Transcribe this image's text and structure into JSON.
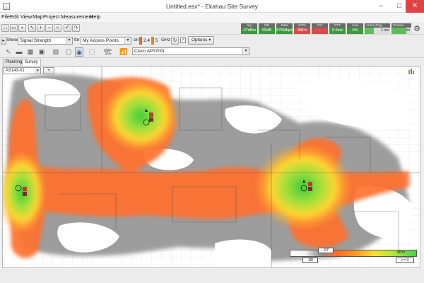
{
  "app": {
    "window_title": "Untitled.esx* - Ekahau Site Survey",
    "min_glyph": "–",
    "max_glyph": "□",
    "close_glyph": "✕"
  },
  "menu": [
    "File",
    "Edit",
    "View",
    "Map",
    "Project",
    "Measurement",
    "Help"
  ],
  "metrics": [
    {
      "label": "Sig",
      "value": "-37dBm",
      "status": "good"
    },
    {
      "label": "S/N",
      "value": "55dB",
      "status": "good"
    },
    {
      "label": "Data",
      "value": "975Mbps",
      "status": "good"
    },
    {
      "label": "#APs",
      "value": "3APs",
      "status": "bad"
    },
    {
      "label": "CCI",
      "value": "-",
      "status": "bad"
    },
    {
      "label": "RTT",
      "value": "0.9ms",
      "status": "good"
    },
    {
      "label": "Loss",
      "value": "0%",
      "status": "good"
    }
  ],
  "active_ping": {
    "label": "Active Ping",
    "value": "1 ms",
    "level": 0.35
  },
  "passive": {
    "label": "Passive",
    "value": "-31dBm",
    "level": 0.75
  },
  "view_bar": {
    "show_label": "Show",
    "visualization": "Signal Strength",
    "for_label": "for",
    "ap_filter": "My Access Points",
    "on_label": "on",
    "band_24": "2.4",
    "band_5": "5",
    "ghz_label": "GHz",
    "options_label": "Options ▾",
    "ap_model": "Cisco AP3700i"
  },
  "tabs": {
    "planning": "Planning",
    "survey": "Survey"
  },
  "floor": {
    "name": "AS143-01",
    "add_label": "+"
  },
  "legend": {
    "value_top": "-67",
    "value_bottom": "-80",
    "unit": "dBm",
    "gte_label": ">= 0"
  },
  "colors": {
    "strong": "#48d248",
    "medium": "#ffdd33",
    "weak": "#ff6a2a",
    "none": "#8c8c8c",
    "accent": "#d64b4b"
  }
}
